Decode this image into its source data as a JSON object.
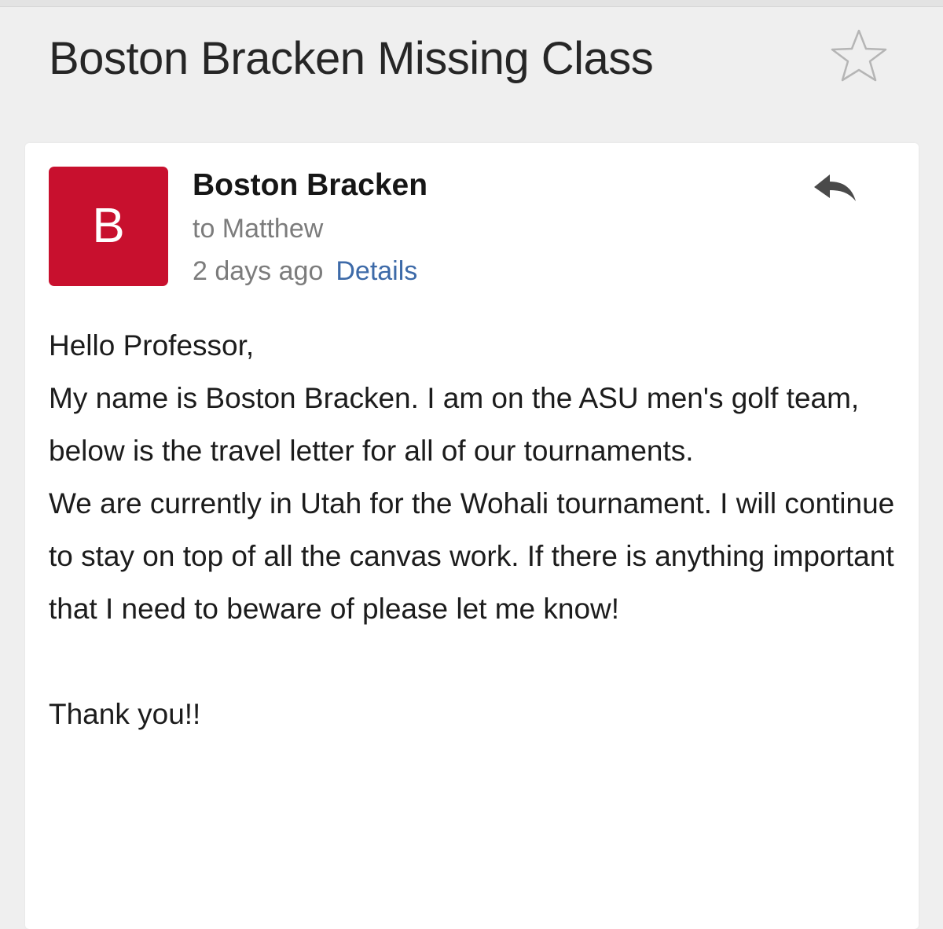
{
  "email": {
    "subject": "Boston Bracken Missing Class",
    "sender_initial": "B",
    "sender_name": "Boston Bracken",
    "recipient": "to Matthew",
    "time": "2 days ago",
    "details_link": "Details",
    "body": {
      "greeting": "Hello Professor,",
      "paragraph_1": "My name is Boston Bracken. I am on the ASU men's golf team, below is the travel letter for all of our tournaments.",
      "paragraph_2": "We are currently in Utah for the Wohali tournament. I will continue to stay on top of all the canvas work. If there is anything important that I need to beware of please let me know!",
      "closing": "Thank you!!"
    }
  },
  "icons": {
    "star": "star-outline-icon",
    "reply": "reply-arrow-icon"
  },
  "colors": {
    "avatar_background": "#c8102e",
    "link": "#3d6aa8"
  }
}
